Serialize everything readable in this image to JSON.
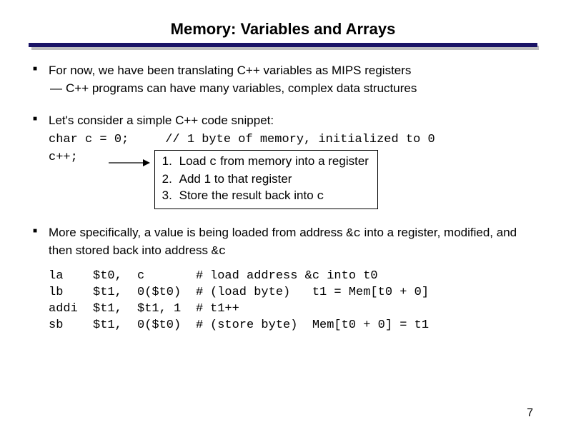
{
  "title": "Memory: Variables and Arrays",
  "bullets": {
    "b1": "For now, we have been translating C++ variables as MIPS registers",
    "b1a": "C++ programs can have many variables, complex data structures",
    "b2": "Let's consider a simple C++ code snippet:",
    "b3_pre": "More specifically, a value is being loaded from address ",
    "b3_c1": "&c",
    "b3_mid": " into a register, modified, and then stored back into address ",
    "b3_c2": "&c"
  },
  "code": {
    "line1": "char c = 0;     // 1 byte of memory, initialized to 0",
    "line2_left": "c++;    "
  },
  "steps": [
    {
      "n": "1.",
      "t_pre": "Load ",
      "t_code": "c",
      "t_post": " from memory into a register"
    },
    {
      "n": "2.",
      "t_pre": "Add 1 to that register",
      "t_code": "",
      "t_post": ""
    },
    {
      "n": "3.",
      "t_pre": "Store the result back into ",
      "t_code": "c",
      "t_post": ""
    }
  ],
  "asm": [
    {
      "op": "la",
      "reg": "$t0,",
      "arg": "c",
      "cmt": "load address &c into t0"
    },
    {
      "op": "lb",
      "reg": "$t1,",
      "arg": "0($t0)",
      "cmt": "(load byte)   t1 = Mem[t0 + 0]"
    },
    {
      "op": "addi",
      "reg": "$t1,",
      "arg": "$t1, 1",
      "cmt": "t1++"
    },
    {
      "op": "sb",
      "reg": "$t1,",
      "arg": "0($t0)",
      "cmt": "(store byte)  Mem[t0 + 0] = t1"
    }
  ],
  "hash": "#",
  "page": "7"
}
